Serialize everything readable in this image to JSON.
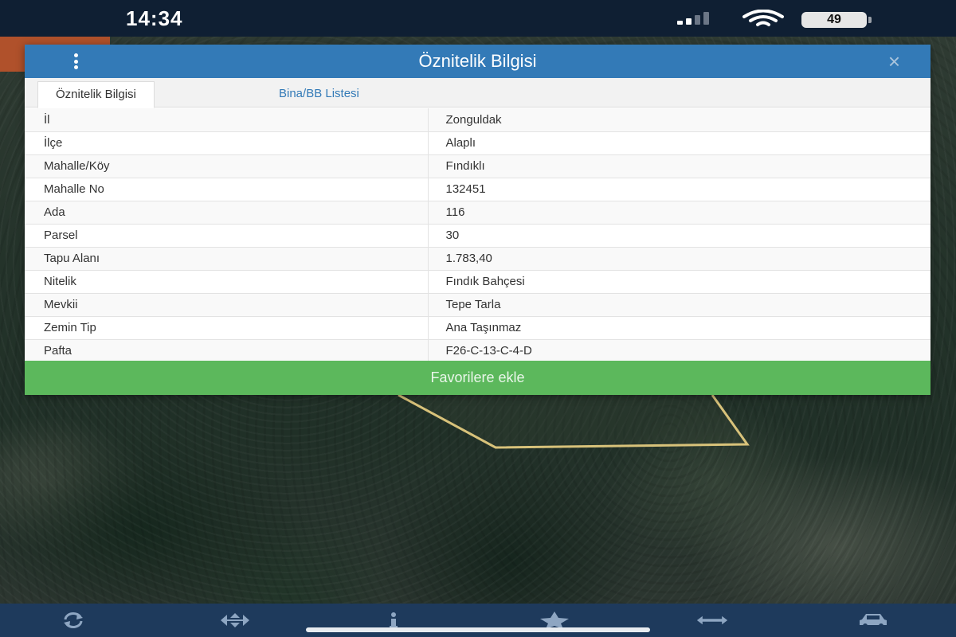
{
  "status_bar": {
    "time": "14:34",
    "battery": "49"
  },
  "dialog": {
    "title": "Öznitelik Bilgisi",
    "close_label": "×",
    "tabs": [
      {
        "label": "Öznitelik Bilgisi",
        "active": true
      },
      {
        "label": "Bina/BB Listesi",
        "active": false
      }
    ],
    "rows": [
      {
        "key": "İl",
        "value": "Zonguldak"
      },
      {
        "key": "İlçe",
        "value": "Alaplı"
      },
      {
        "key": "Mahalle/Köy",
        "value": "Fındıklı"
      },
      {
        "key": "Mahalle No",
        "value": "132451"
      },
      {
        "key": "Ada",
        "value": "116"
      },
      {
        "key": "Parsel",
        "value": "30"
      },
      {
        "key": "Tapu Alanı",
        "value": "1.783,40"
      },
      {
        "key": "Nitelik",
        "value": "Fındık Bahçesi"
      },
      {
        "key": "Mevkii",
        "value": "Tepe Tarla"
      },
      {
        "key": "Zemin Tip",
        "value": "Ana Taşınmaz"
      },
      {
        "key": "Pafta",
        "value": "F26-C-13-C-4-D"
      }
    ],
    "favorite_button": "Favorilere ekle"
  },
  "toolbar": {
    "tools": [
      {
        "icon": "refresh-icon"
      },
      {
        "icon": "move-icon"
      },
      {
        "icon": "info-icon"
      },
      {
        "icon": "star-icon"
      },
      {
        "icon": "measure-icon"
      },
      {
        "icon": "car-icon"
      }
    ]
  },
  "colors": {
    "header_blue": "#337ab7",
    "favorite_green": "#5cb85c",
    "status_bar": "#0f1f33",
    "toolbar": "#1e3a5c",
    "parcel_outline": "#d8c27a"
  }
}
